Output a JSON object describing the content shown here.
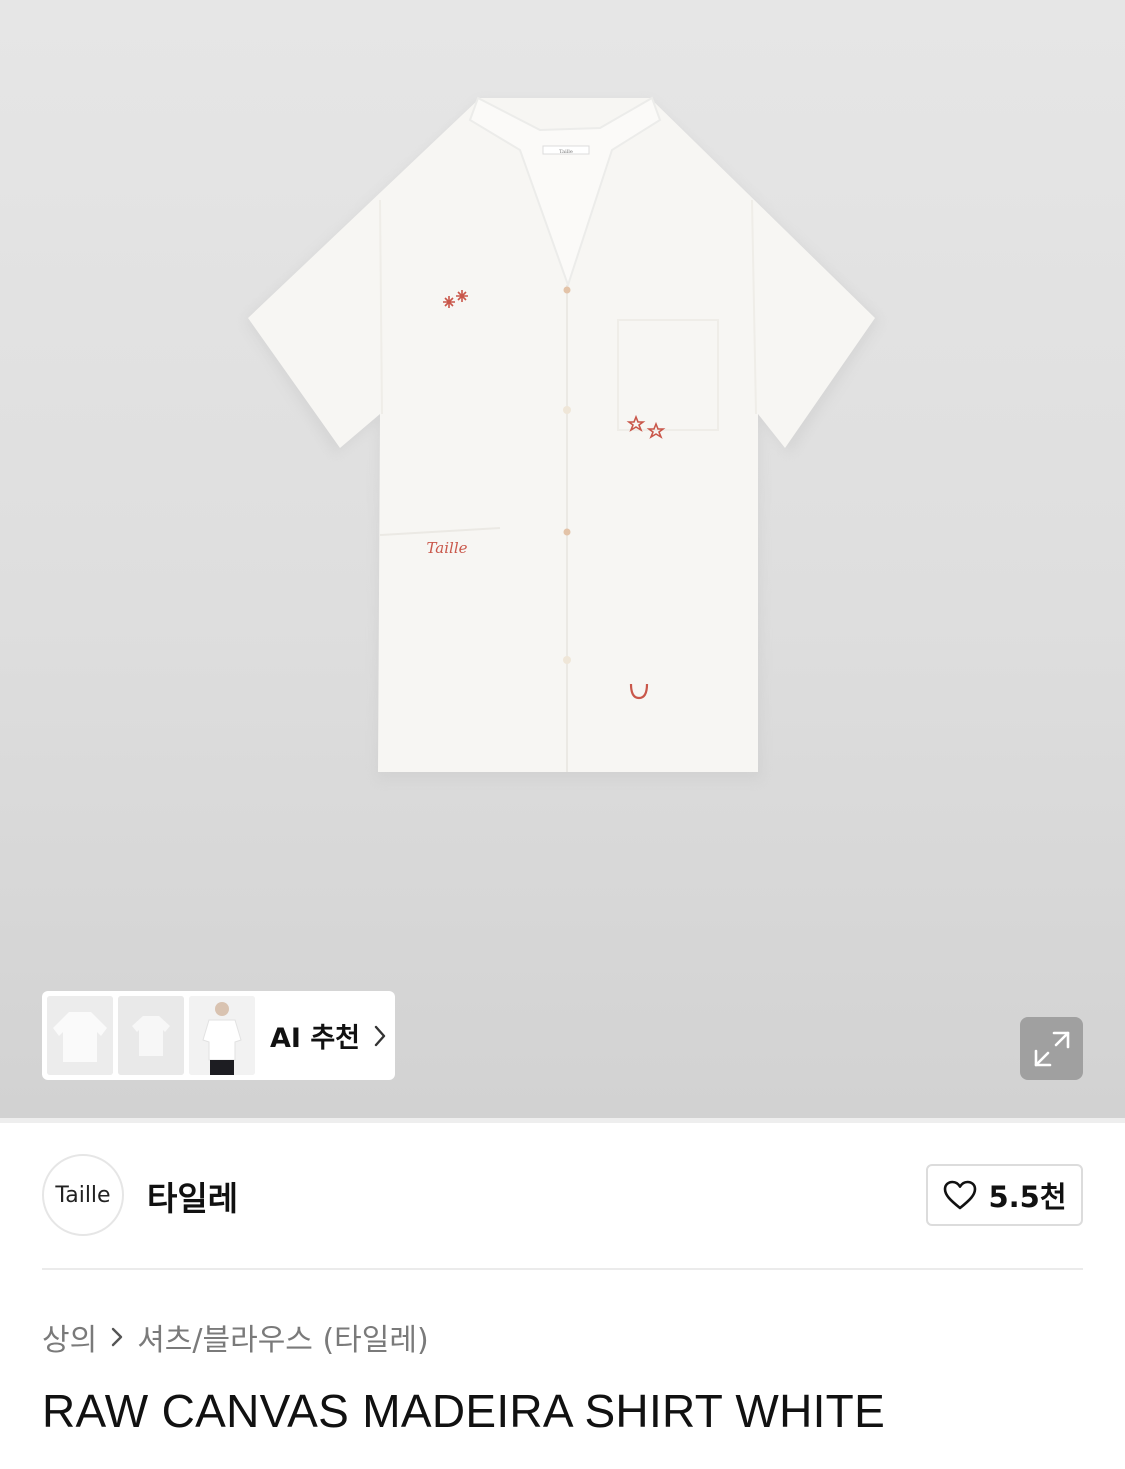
{
  "gallery": {
    "thumbnails": [
      {
        "name": "shirt-front-flat"
      },
      {
        "name": "shirt-folded"
      },
      {
        "name": "model-wearing-shirt"
      }
    ],
    "ai_recommend_label": "AI 추천",
    "expand_icon": "expand-icon"
  },
  "shirt_label": "Taille",
  "embroidery_text": "Taille",
  "brand": {
    "logo_text": "Taille",
    "name": "타일레"
  },
  "like": {
    "icon": "heart-icon",
    "count": "5.5천"
  },
  "breadcrumb": {
    "category": "상의",
    "subcategory": "셔츠/블라우스 (타일레)"
  },
  "product": {
    "title": "RAW CANVAS MADEIRA SHIRT WHITE"
  },
  "colors": {
    "embroidery": "#c9574a",
    "shirt": "#f7f6f3"
  }
}
